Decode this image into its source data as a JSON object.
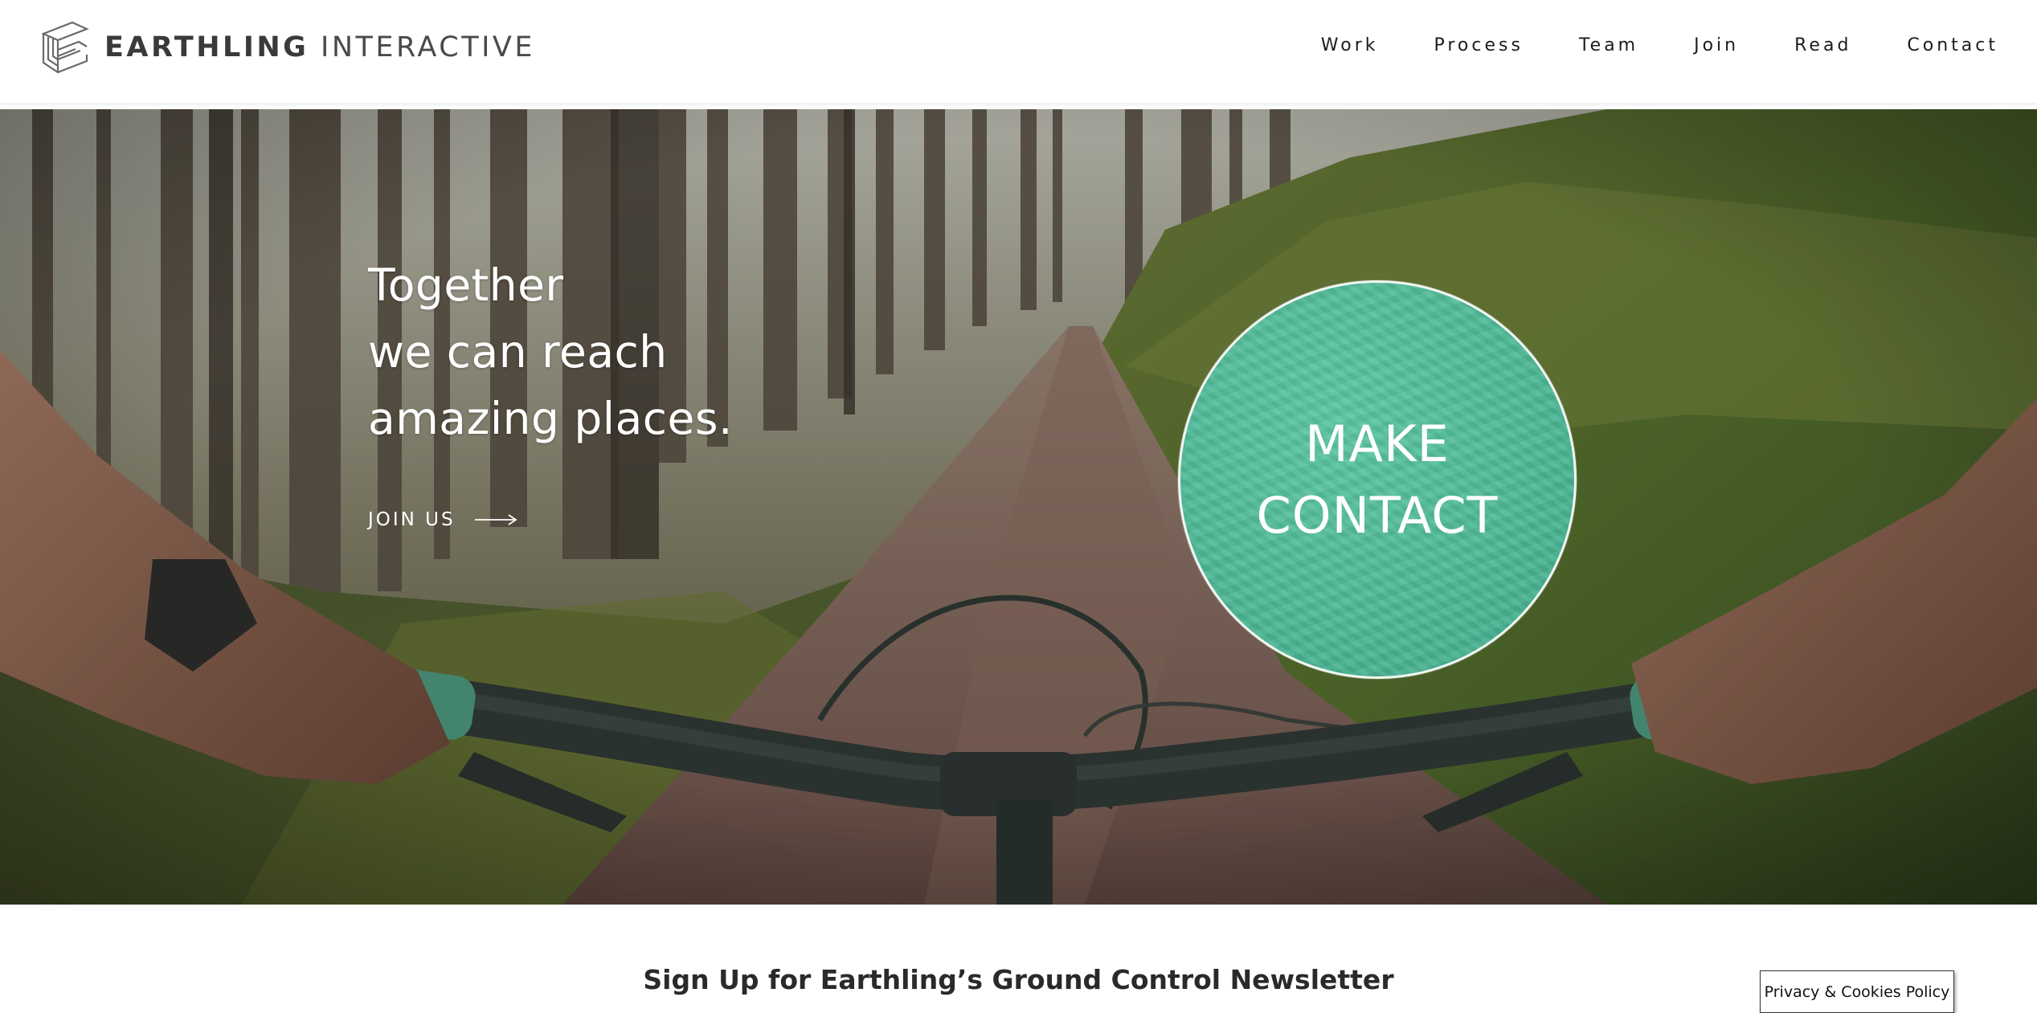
{
  "brand": {
    "name_bold": "EARTHLING",
    "name_light": "INTERACTIVE"
  },
  "nav": {
    "items": [
      {
        "label": "Work"
      },
      {
        "label": "Process"
      },
      {
        "label": "Team"
      },
      {
        "label": "Join"
      },
      {
        "label": "Read"
      },
      {
        "label": "Contact"
      }
    ]
  },
  "hero": {
    "headline": [
      "Together",
      "we can reach",
      "amazing places."
    ],
    "cta_label": "JOIN US",
    "contact_lines": [
      "MAKE",
      "CONTACT"
    ]
  },
  "newsletter": {
    "title": "Sign Up for Earthling’s Ground Control Newsletter"
  },
  "privacy": {
    "label": "Privacy & Cookies Policy"
  },
  "colors": {
    "accent": "#4eb996",
    "nav_text": "#1c1c1c",
    "logo_text": "#3a3a3a",
    "hero_text": "#ffffff"
  },
  "icons": {
    "logo": "earthling-e-mark-icon",
    "cta_arrow": "long-arrow-right-icon"
  }
}
